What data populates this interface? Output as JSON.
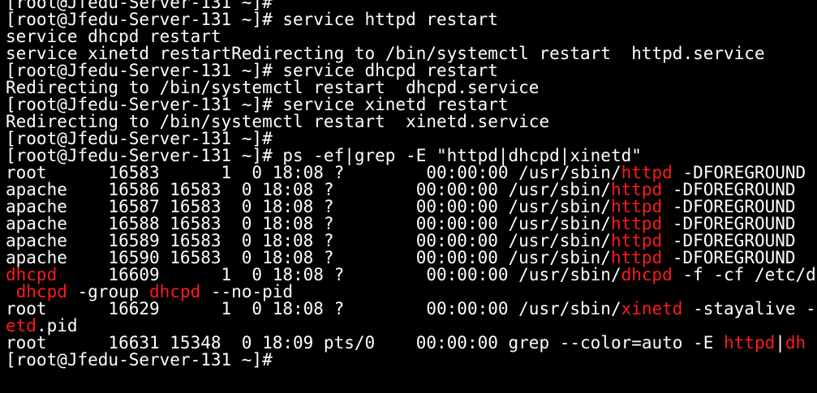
{
  "terminal": {
    "colors": {
      "background": "#000000",
      "foreground": "#ffffff",
      "match_highlight": "#ff1a1a"
    },
    "lines": [
      [
        {
          "t": "[root@Jfedu-Server-131 ~]#"
        }
      ],
      [
        {
          "t": "[root@Jfedu-Server-131 ~]# service httpd restart"
        }
      ],
      [
        {
          "t": "service dhcpd restart"
        }
      ],
      [
        {
          "t": "service xinetd restartRedirecting to /bin/systemctl restart  httpd.service"
        }
      ],
      [
        {
          "t": "[root@Jfedu-Server-131 ~]# service dhcpd restart"
        }
      ],
      [
        {
          "t": "Redirecting to /bin/systemctl restart  dhcpd.service"
        }
      ],
      [
        {
          "t": "[root@Jfedu-Server-131 ~]# service xinetd restart"
        }
      ],
      [
        {
          "t": "Redirecting to /bin/systemctl restart  xinetd.service"
        }
      ],
      [
        {
          "t": "[root@Jfedu-Server-131 ~]#"
        }
      ],
      [
        {
          "t": "[root@Jfedu-Server-131 ~]# ps -ef|grep -E \"httpd|dhcpd|xinetd\""
        }
      ],
      [
        {
          "t": "root      16583      1  0 18:08 ?        00:00:00 /usr/sbin/"
        },
        {
          "t": "httpd",
          "hl": true
        },
        {
          "t": " -DFOREGROUND"
        }
      ],
      [
        {
          "t": "apache    16586 16583  0 18:08 ?        00:00:00 /usr/sbin/"
        },
        {
          "t": "httpd",
          "hl": true
        },
        {
          "t": " -DFOREGROUND"
        }
      ],
      [
        {
          "t": "apache    16587 16583  0 18:08 ?        00:00:00 /usr/sbin/"
        },
        {
          "t": "httpd",
          "hl": true
        },
        {
          "t": " -DFOREGROUND"
        }
      ],
      [
        {
          "t": "apache    16588 16583  0 18:08 ?        00:00:00 /usr/sbin/"
        },
        {
          "t": "httpd",
          "hl": true
        },
        {
          "t": " -DFOREGROUND"
        }
      ],
      [
        {
          "t": "apache    16589 16583  0 18:08 ?        00:00:00 /usr/sbin/"
        },
        {
          "t": "httpd",
          "hl": true
        },
        {
          "t": " -DFOREGROUND"
        }
      ],
      [
        {
          "t": "apache    16590 16583  0 18:08 ?        00:00:00 /usr/sbin/"
        },
        {
          "t": "httpd",
          "hl": true
        },
        {
          "t": " -DFOREGROUND"
        }
      ],
      [
        {
          "t": "dhcpd",
          "hl": true
        },
        {
          "t": "     16609      1  0 18:08 ?        00:00:00 /usr/sbin/"
        },
        {
          "t": "dhcpd",
          "hl": true
        },
        {
          "t": " -f -cf /etc/d"
        }
      ],
      [
        {
          "t": " "
        },
        {
          "t": "dhcpd",
          "hl": true
        },
        {
          "t": " -group "
        },
        {
          "t": "dhcpd",
          "hl": true
        },
        {
          "t": " --no-pid"
        }
      ],
      [
        {
          "t": "root      16629      1  0 18:08 ?        00:00:00 /usr/sbin/"
        },
        {
          "t": "xinetd",
          "hl": true
        },
        {
          "t": " -stayalive -"
        }
      ],
      [
        {
          "t": "etd",
          "hl": true
        },
        {
          "t": ".pid"
        }
      ],
      [
        {
          "t": "root      16631 15348  0 18:09 pts/0    00:00:00 grep --color=auto -E "
        },
        {
          "t": "httpd",
          "hl": true
        },
        {
          "t": "|"
        },
        {
          "t": "dh",
          "hl": true
        }
      ],
      [
        {
          "t": "[root@Jfedu-Server-131 ~]#"
        }
      ]
    ]
  }
}
